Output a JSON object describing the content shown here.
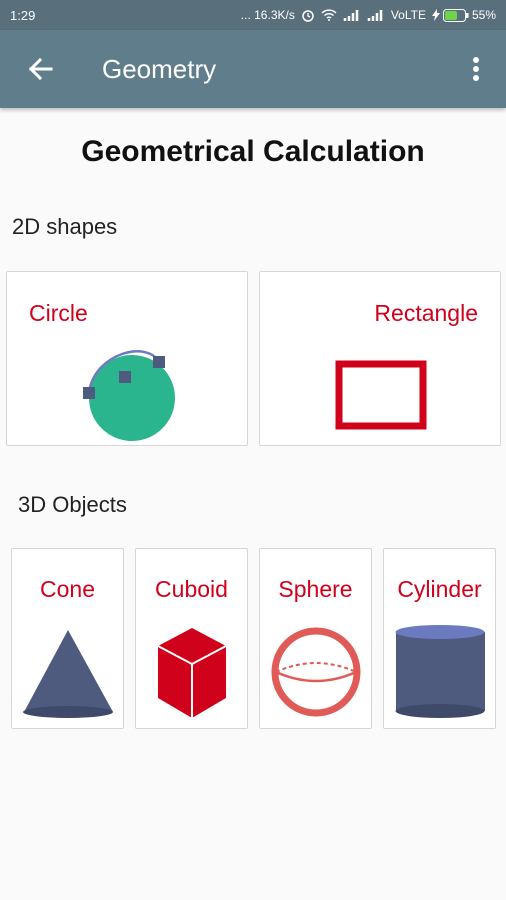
{
  "status_bar": {
    "time": "1:29",
    "speed": "... 16.3K/s",
    "network": "VoLTE",
    "battery": "55%"
  },
  "app_bar": {
    "title": "Geometry"
  },
  "page": {
    "title": "Geometrical Calculation"
  },
  "sections": {
    "two_d": {
      "label": "2D shapes",
      "items": [
        {
          "label": "Circle",
          "icon": "circle-icon"
        },
        {
          "label": "Rectangle",
          "icon": "rectangle-icon"
        }
      ]
    },
    "three_d": {
      "label": "3D Objects",
      "items": [
        {
          "label": "Cone",
          "icon": "cone-icon"
        },
        {
          "label": "Cuboid",
          "icon": "cuboid-icon"
        },
        {
          "label": "Sphere",
          "icon": "sphere-icon"
        },
        {
          "label": "Cylinder",
          "icon": "cylinder-icon"
        }
      ]
    }
  },
  "colors": {
    "status_bar": "#596f7b",
    "app_bar": "#607d8b",
    "label_red": "#d0021b",
    "shape_slate": "#4f5b7e",
    "circle_green": "#2bb58e",
    "sphere_red": "#e05a57"
  }
}
